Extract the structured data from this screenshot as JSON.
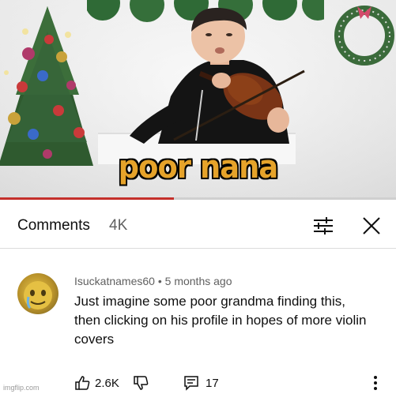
{
  "video": {
    "caption": "poor nana",
    "progress_fraction": 0.44
  },
  "comments": {
    "title": "Comments",
    "count": "4K"
  },
  "comment": {
    "author": "Isuckatnames60",
    "separator": "•",
    "time": "5 months ago",
    "text": "Just imagine some poor grandma finding this, then clicking on his profile in hopes of more violin covers",
    "likes": "2.6K",
    "replies": "17"
  },
  "watermark": "imgflip.com",
  "icons": {
    "filter": "filter-sliders-icon",
    "close": "close-icon",
    "like": "thumbs-up-icon",
    "dislike": "thumbs-down-icon",
    "reply": "reply-icon",
    "more": "more-vertical-icon"
  },
  "colors": {
    "caption_fill": "#e6a32a",
    "progress": "#c4302b",
    "text_primary": "#0f0f0f",
    "text_secondary": "#606060"
  }
}
